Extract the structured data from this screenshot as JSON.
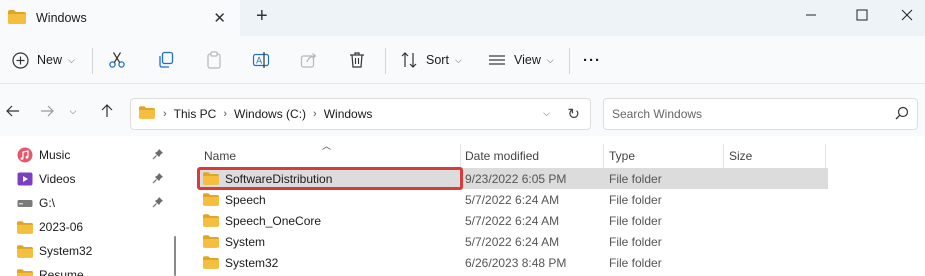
{
  "window": {
    "tab_title": "Windows",
    "new_tab_label": "+",
    "close_tab_label": "✕"
  },
  "toolbar": {
    "new_label": "New",
    "sort_label": "Sort",
    "view_label": "View",
    "more_label": "···"
  },
  "address": {
    "crumbs": [
      "This PC",
      "Windows (C:)",
      "Windows"
    ]
  },
  "search": {
    "placeholder": "Search Windows"
  },
  "sidebar": {
    "items": [
      {
        "label": "Music",
        "icon": "music-icon",
        "pinned": true
      },
      {
        "label": "Videos",
        "icon": "videos-icon",
        "pinned": true
      },
      {
        "label": "G:\\",
        "icon": "drive-icon",
        "pinned": true
      },
      {
        "label": "2023-06",
        "icon": "folder-icon",
        "pinned": false
      },
      {
        "label": "System32",
        "icon": "folder-icon",
        "pinned": false
      },
      {
        "label": "Resume",
        "icon": "folder-icon",
        "pinned": false
      }
    ]
  },
  "columns": {
    "name": "Name",
    "date": "Date modified",
    "type": "Type",
    "size": "Size"
  },
  "files": [
    {
      "name": "SoftwareDistribution",
      "date": "9/23/2022 6:05 PM",
      "type": "File folder",
      "selected": true
    },
    {
      "name": "Speech",
      "date": "5/7/2022 6:24 AM",
      "type": "File folder",
      "selected": false
    },
    {
      "name": "Speech_OneCore",
      "date": "5/7/2022 6:24 AM",
      "type": "File folder",
      "selected": false
    },
    {
      "name": "System",
      "date": "5/7/2022 6:24 AM",
      "type": "File folder",
      "selected": false
    },
    {
      "name": "System32",
      "date": "6/26/2023 8:48 PM",
      "type": "File folder",
      "selected": false
    }
  ],
  "colors": {
    "folder": "#f4bf3f",
    "folder_dark": "#e0a526",
    "highlight": "#d93a3a",
    "selected_row": "#dcdcdc"
  }
}
